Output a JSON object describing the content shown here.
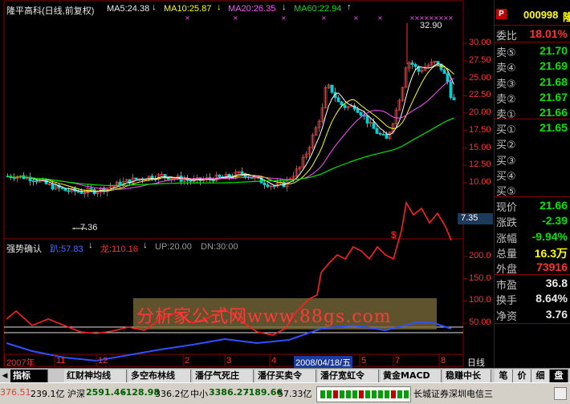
{
  "header": {
    "stock_name": "隆平高科(日线,前复权)",
    "ma5": "MA5:24.38",
    "ma10": "MA10:25.87",
    "ma20": "MA20:26.35",
    "ma60": "MA60:22.94",
    "stock_code": "000998",
    "stock_short": "隆"
  },
  "chart": {
    "price_axis": [
      "30.00",
      "27.50",
      "25.00",
      "22.50",
      "20.00",
      "17.50",
      "15.00",
      "12.50",
      "10.00"
    ],
    "price_marker": "7.35",
    "high_label": "32.90",
    "low_label": "7.36",
    "dollar_mark": "$",
    "indicator": {
      "name": "强势确认",
      "v1": "趴:57.83",
      "v2": "龙:110.16",
      "up": "UP:20.00",
      "dn": "DN:30:00",
      "axis": [
        "200.0",
        "150.0",
        "100.0",
        "50.00"
      ]
    },
    "watermark": "分析家公式网www.88gs.com",
    "x_axis": [
      "2007年",
      "11",
      "12",
      "2",
      "3",
      "4",
      "5",
      "7",
      "8"
    ],
    "date_cursor": "2008/04/18/五",
    "period": "日线"
  },
  "chart_data": {
    "type": "line",
    "x": [
      "2007-10",
      "2007-11",
      "2007-12",
      "2008-01",
      "2008-02",
      "2008-03",
      "2008-04",
      "2008-05",
      "2008-06",
      "2008-07",
      "2008-08"
    ],
    "series": [
      {
        "name": "MA60",
        "values": [
          10.9,
          10.2,
          9.5,
          9.3,
          9.2,
          9.2,
          9.8,
          12.5,
          15.6,
          19.3,
          22.9
        ]
      },
      {
        "name": "趴",
        "values": [
          40,
          30,
          20,
          22,
          30,
          28,
          20,
          80,
          70,
          60,
          57.83
        ]
      },
      {
        "name": "龙",
        "values": [
          60,
          20,
          10,
          15,
          35,
          30,
          20,
          150,
          110,
          190,
          110.16
        ]
      }
    ],
    "ylim_price": [
      7.35,
      32.9
    ],
    "ylim_indicator": [
      0,
      200
    ]
  },
  "right_panel": {
    "ratio_label": "委比",
    "ratio_value": "18.01%",
    "sell": [
      {
        "label": "卖⑤",
        "value": "21.70"
      },
      {
        "label": "卖④",
        "value": "21.69"
      },
      {
        "label": "卖③",
        "value": "21.68"
      },
      {
        "label": "卖②",
        "value": "21.67"
      },
      {
        "label": "卖①",
        "value": "21.66"
      }
    ],
    "buy": [
      {
        "label": "买①",
        "value": "21.65"
      },
      {
        "label": "买②",
        "value": ""
      },
      {
        "label": "买③",
        "value": ""
      },
      {
        "label": "买④",
        "value": ""
      },
      {
        "label": "买⑤",
        "value": ""
      }
    ],
    "stats": [
      {
        "label": "现价",
        "value": "21.66"
      },
      {
        "label": "涨跌",
        "value": "-2.39"
      },
      {
        "label": "涨幅",
        "value": "-9.94%"
      },
      {
        "label": "总量",
        "value": "16.3万"
      },
      {
        "label": "外盘",
        "value": "73916"
      }
    ],
    "stats2": [
      {
        "label": "市盈",
        "value": "36.8"
      },
      {
        "label": "换手",
        "value": "8.64%"
      },
      {
        "label": "净资",
        "value": "3.76"
      }
    ]
  },
  "tabs": [
    "指标",
    "红财神均线",
    "多空布林线",
    "潘仔气死庄",
    "潘仔买卖令",
    "潘仔宽虹令",
    "黄金MACD",
    "稳赚中长"
  ],
  "side_tabs": [
    "笔",
    "价",
    "细",
    "盘"
  ],
  "status": {
    "sh": "376.51",
    "sh_amt": "239.1亿",
    "sz_label": "沪深",
    "sz": "2591.46",
    "sz_chg": "-128.98",
    "sz_amt": "336.2亿",
    "mid_label": "中小",
    "mid": "3386.27",
    "mid_chg": "-189.66",
    "mid_amt": "57.33亿",
    "broker": "长城证券深圳电信三"
  }
}
